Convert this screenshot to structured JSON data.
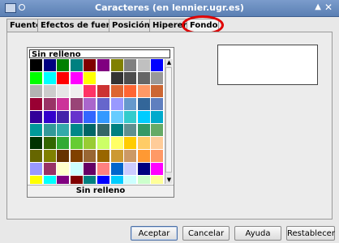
{
  "window": {
    "title": "Caracteres (en lennier.ugr.es)"
  },
  "tabs": [
    {
      "label": "Fuente",
      "active": false
    },
    {
      "label": "Efectos de fuente",
      "active": false
    },
    {
      "label": "Posición",
      "active": false
    },
    {
      "label": "Hiperenlace",
      "active": false
    },
    {
      "label": "Fondo",
      "active": true
    }
  ],
  "background": {
    "selected_label": "Sin relleno",
    "footer_label": "Sin relleno",
    "colors": [
      "#000000",
      "#000080",
      "#008000",
      "#008080",
      "#800000",
      "#800080",
      "#808000",
      "#808080",
      "#c0c0c0",
      "#0000ff",
      "#00ff00",
      "#00ffff",
      "#ff0000",
      "#ff00ff",
      "#ffff00",
      "#ffffff",
      "#333333",
      "#4d4d4d",
      "#666666",
      "#999999",
      "#b3b3b3",
      "#cccccc",
      "#e6e6e6",
      "#f0f0f0",
      "#ff3366",
      "#cc3333",
      "#dd6633",
      "#ff6633",
      "#ff9966",
      "#cc6633",
      "#990033",
      "#993366",
      "#cc3399",
      "#994477",
      "#aa66cc",
      "#6666cc",
      "#9999ff",
      "#6699cc",
      "#336699",
      "#5f7fbf",
      "#330099",
      "#3300cc",
      "#4422aa",
      "#6633cc",
      "#3366ff",
      "#3399ff",
      "#66ccff",
      "#33cccc",
      "#00ccff",
      "#00aacc",
      "#009999",
      "#339999",
      "#33aaaa",
      "#008888",
      "#006666",
      "#336666",
      "#008080",
      "#5f8f8f",
      "#339966",
      "#66aa66",
      "#003300",
      "#336600",
      "#33aa33",
      "#66cc33",
      "#99cc33",
      "#ccff66",
      "#ffff66",
      "#ffcc00",
      "#ffcc66",
      "#ffcc99",
      "#666600",
      "#808000",
      "#663300",
      "#804000",
      "#996633",
      "#996600",
      "#cc9933",
      "#cc9966",
      "#ff9933",
      "#ff9966",
      "#9999ff",
      "#993366",
      "#ffffcc",
      "#ccffff",
      "#660066",
      "#ff8080",
      "#0066cc",
      "#ccccff",
      "#000080",
      "#ff00ff",
      "#ffff00",
      "#00ffff",
      "#800080",
      "#800000",
      "#008080",
      "#0000ff",
      "#00ccff",
      "#ccffff",
      "#ccffcc",
      "#ffff99"
    ]
  },
  "buttons": {
    "ok": "Aceptar",
    "cancel": "Cancelar",
    "help": "Ayuda",
    "reset": "Restablecer"
  },
  "icons": {
    "window": "app-icon",
    "pin": "pin-icon",
    "up": "up-arrow-icon",
    "close": "close-icon"
  },
  "colors": {
    "titlebar": "#6a8cbf",
    "highlight_ring": "#e00000"
  }
}
